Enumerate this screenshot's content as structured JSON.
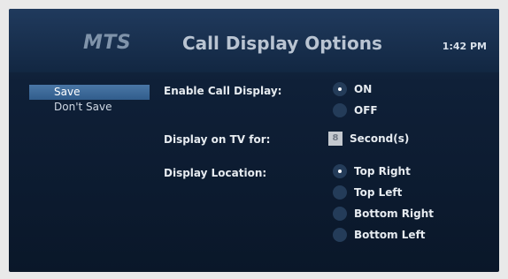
{
  "header": {
    "logo": "MTS",
    "title": "Call Display Options",
    "time": "1:42 PM"
  },
  "menu": {
    "items": [
      {
        "label": "Save",
        "selected": true
      },
      {
        "label": "Don't Save",
        "selected": false
      }
    ]
  },
  "settings": {
    "enable_call_display": {
      "label": "Enable Call Display:",
      "options": [
        {
          "label": "ON",
          "selected": true
        },
        {
          "label": "OFF",
          "selected": false
        }
      ]
    },
    "display_on_tv": {
      "label": "Display on TV for:",
      "value": "8",
      "unit": "Second(s)"
    },
    "display_location": {
      "label": "Display Location:",
      "options": [
        {
          "label": "Top Right",
          "selected": true
        },
        {
          "label": "Top Left",
          "selected": false
        },
        {
          "label": "Bottom Right",
          "selected": false
        },
        {
          "label": "Bottom Left",
          "selected": false
        }
      ]
    }
  }
}
